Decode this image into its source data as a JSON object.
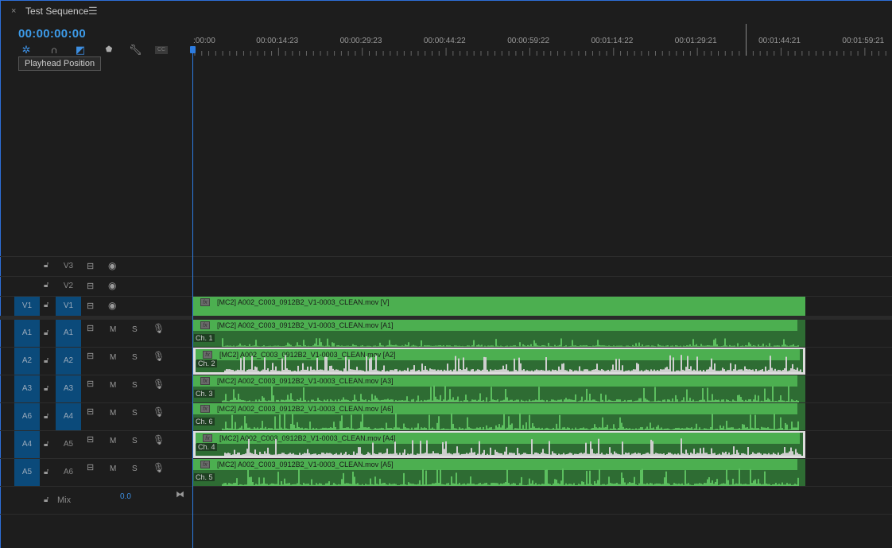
{
  "tab": {
    "close": "×",
    "title": "Test Sequence",
    "menu": "☰"
  },
  "timecode": "00:00:00:00",
  "toolbar": {
    "tools": [
      "snap-insert-icon",
      "magnet-icon",
      "linked-selection-icon",
      "marker-icon",
      "wrench-icon",
      "captions-icon"
    ],
    "cc": "CC",
    "tooltip": "Playhead Position"
  },
  "ruler": {
    "labels": [
      ":00:00",
      "00:00:14:23",
      "00:00:29:23",
      "00:00:44:22",
      "00:00:59:22",
      "00:01:14:22",
      "00:01:29:21",
      "00:01:44:21",
      "00:01:59:21"
    ]
  },
  "colors": {
    "accent": "#2d7ce0",
    "clip": "#4caf50",
    "audio_bg": "#2e6c33",
    "target": "#0b4a7a"
  },
  "video_tracks": [
    {
      "src": "",
      "name": "V3"
    },
    {
      "src": "",
      "name": "V2"
    },
    {
      "src": "V1",
      "name": "V1",
      "clip": "[MC2] A002_C003_0912B2_V1-0003_CLEAN.mov [V]"
    }
  ],
  "audio_tracks": [
    {
      "src": "A1",
      "name": "A1",
      "targeted": true,
      "clip": "[MC2] A002_C003_0912B2_V1-0003_CLEAN.mov [A1]",
      "ch": "Ch. 1",
      "selected": false
    },
    {
      "src": "A2",
      "name": "A2",
      "targeted": true,
      "clip": "[MC2] A002_C003_0912B2_V1-0003_CLEAN.mov [A2]",
      "ch": "Ch. 2",
      "selected": true
    },
    {
      "src": "A3",
      "name": "A3",
      "targeted": true,
      "clip": "[MC2] A002_C003_0912B2_V1-0003_CLEAN.mov [A3]",
      "ch": "Ch. 3",
      "selected": false
    },
    {
      "src": "A6",
      "name": "A4",
      "targeted": true,
      "clip": "[MC2] A002_C003_0912B2_V1-0003_CLEAN.mov [A6]",
      "ch": "Ch. 6",
      "selected": false
    },
    {
      "src": "A4",
      "name": "A5",
      "targeted": false,
      "clip": "[MC2] A002_C003_0912B2_V1-0003_CLEAN.mov [A4]",
      "ch": "Ch. 4",
      "selected": true
    },
    {
      "src": "A5",
      "name": "A6",
      "targeted": false,
      "clip": "[MC2] A002_C003_0912B2_V1-0003_CLEAN.mov [A5]",
      "ch": "Ch. 5",
      "selected": false
    }
  ],
  "audio_buttons": {
    "mute": "M",
    "solo": "S"
  },
  "mix": {
    "label": "Mix",
    "value": "0.0"
  }
}
